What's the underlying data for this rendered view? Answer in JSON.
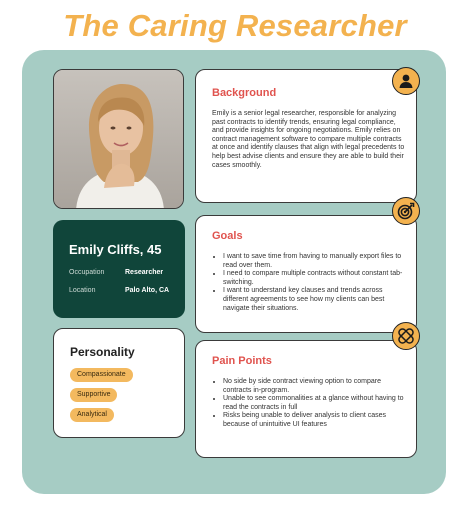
{
  "title": "The Caring Researcher",
  "persona": {
    "name": "Emily Cliffs, 45",
    "occupation_label": "Occupation",
    "occupation": "Researcher",
    "location_label": "Location",
    "location": "Palo Alto, CA"
  },
  "personality": {
    "heading": "Personality",
    "traits": [
      "Compassionate",
      "Supportive",
      "Analytical"
    ]
  },
  "background": {
    "heading": "Background",
    "text": "Emily is a senior legal researcher, responsible for analyzing past contracts to identify trends, ensuring legal compliance, and provide insights for ongoing negotiations. Emily relies on contract management software to compare multiple contracts at once and identify clauses that align with legal precedents to help best advise clients and ensure they are able to build their cases smoothly."
  },
  "goals": {
    "heading": "Goals",
    "items": [
      "I want to save time from having to manually export files to read over them.",
      "I need to compare multiple contracts without constant tab-switching.",
      "I want to understand key clauses and trends across different agreements to see how my clients can best navigate their situations."
    ]
  },
  "pain_points": {
    "heading": "Pain Points",
    "items": [
      "No side by side contract viewing option to compare contracts in-program.",
      "Unable to see commonalities at a glance without having to read the contracts in full",
      "Risks being unable to deliver analysis to client cases because of unintuitive UI features"
    ]
  },
  "icons": {
    "background": "person-icon",
    "goals": "target-icon",
    "pain_points": "bandage-icon"
  },
  "colors": {
    "accent": "#f3b24f",
    "panel": "#a6ccc4",
    "id_card": "#10453a",
    "heading": "#e0534e"
  }
}
